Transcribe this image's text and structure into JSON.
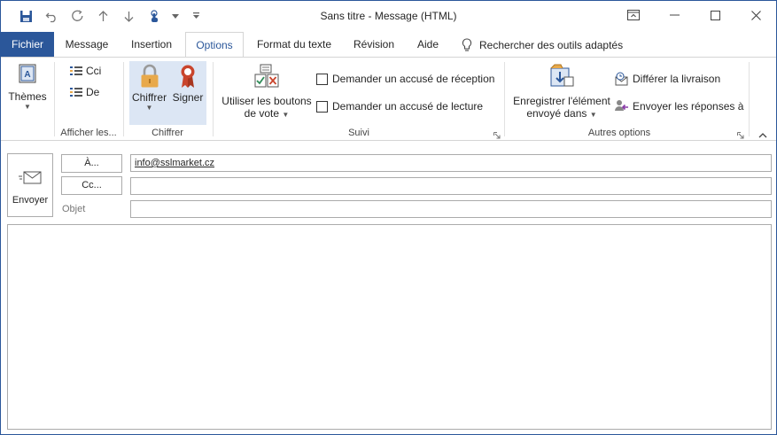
{
  "window": {
    "title": "Sans titre  -  Message (HTML)"
  },
  "tabs": {
    "file": "Fichier",
    "message": "Message",
    "insert": "Insertion",
    "options": "Options",
    "format": "Format du texte",
    "review": "Révision",
    "help": "Aide",
    "tell_me": "Rechercher des outils adaptés"
  },
  "ribbon": {
    "themes": {
      "label": "Thèmes"
    },
    "show_fields": {
      "bcc": "Cci",
      "from": "De",
      "group_label": "Afficher les..."
    },
    "encrypt": {
      "encrypt": "Chiffrer",
      "sign": "Signer",
      "group_label": "Chiffrer"
    },
    "tracking": {
      "voting_line1": "Utiliser les boutons",
      "voting_line2": "de vote",
      "delivery_receipt": "Demander un accusé de réception",
      "read_receipt": "Demander un accusé de lecture",
      "group_label": "Suivi"
    },
    "more_options": {
      "save_line1": "Enregistrer l'élément",
      "save_line2": "envoyé dans",
      "delay_delivery": "Différer la livraison",
      "direct_replies": "Envoyer les réponses à",
      "group_label": "Autres options"
    }
  },
  "compose": {
    "send": "Envoyer",
    "to_button": "À...",
    "cc_button": "Cc...",
    "subject_label": "Objet",
    "to_value": "info@sslmarket.cz",
    "cc_value": "",
    "subject_value": ""
  },
  "colors": {
    "accent": "#2b579a",
    "lock": "#e8a94b",
    "ribbon_red": "#c9452d"
  }
}
